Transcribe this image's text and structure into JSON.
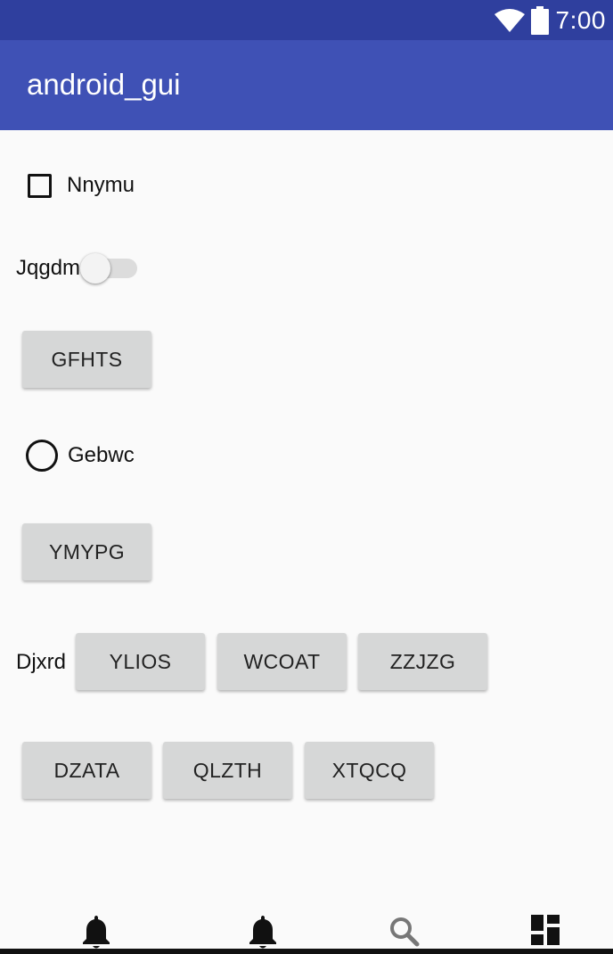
{
  "status_bar": {
    "time": "7:00",
    "icons": [
      "wifi-icon",
      "battery-icon"
    ]
  },
  "app_bar": {
    "title": "android_gui"
  },
  "form": {
    "checkbox": {
      "label": "Nnymu",
      "checked": false
    },
    "switch": {
      "label": "Jqgdm",
      "on": false
    },
    "button_1": "GFHTS",
    "radio": {
      "label": "Gebwc",
      "selected": false
    },
    "button_2": "YMYPG",
    "row_1": {
      "label": "Djxrd",
      "buttons": [
        "YLIOS",
        "WCOAT",
        "ZZJZG"
      ]
    },
    "row_2": {
      "buttons": [
        "DZATA",
        "QLZTH",
        "XTQCQ"
      ]
    }
  },
  "bottom_nav": {
    "items": [
      "bell-icon",
      "bell-icon",
      "search-icon",
      "dashboard-icon"
    ]
  },
  "colors": {
    "status_bar": "#2f3f9e",
    "app_bar": "#3f51b5",
    "background": "#fafafa",
    "button": "#d6d7d7"
  }
}
